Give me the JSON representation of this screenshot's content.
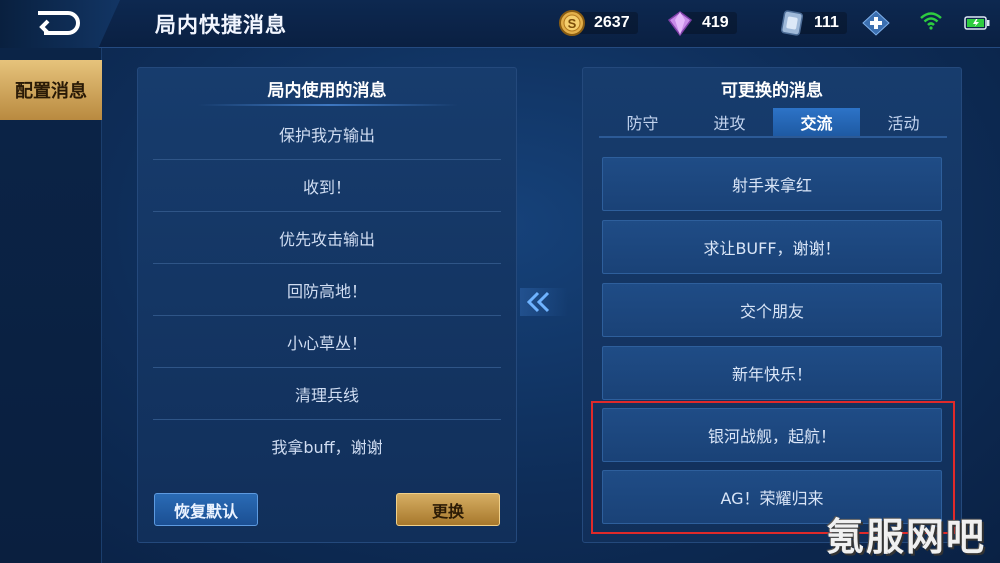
{
  "header": {
    "title": "局内快捷消息",
    "back_icon": "back-arrow-icon"
  },
  "currencies": {
    "gold": "2637",
    "gems": "419",
    "vouchers": "111"
  },
  "sidebar": {
    "active_tab": "配置消息"
  },
  "left_panel": {
    "title": "局内使用的消息",
    "messages": [
      "保护我方输出",
      "收到！",
      "优先攻击输出",
      "回防高地！",
      "小心草丛！",
      "清理兵线",
      "我拿buff，谢谢"
    ],
    "restore_label": "恢复默认",
    "replace_label": "更换"
  },
  "right_panel": {
    "title": "可更换的消息",
    "tabs": [
      "防守",
      "进攻",
      "交流",
      "活动"
    ],
    "active_tab_index": 2,
    "options": [
      "射手来拿红",
      "求让BUFF，谢谢！",
      "交个朋友",
      "新年快乐！",
      "银河战舰，起航！",
      "AG！荣耀归来"
    ]
  },
  "watermark": "氪服网吧",
  "colors": {
    "accent_blue": "#2d73c7",
    "gold_button": "#d6ae63",
    "highlight_red": "#e02a2a"
  }
}
